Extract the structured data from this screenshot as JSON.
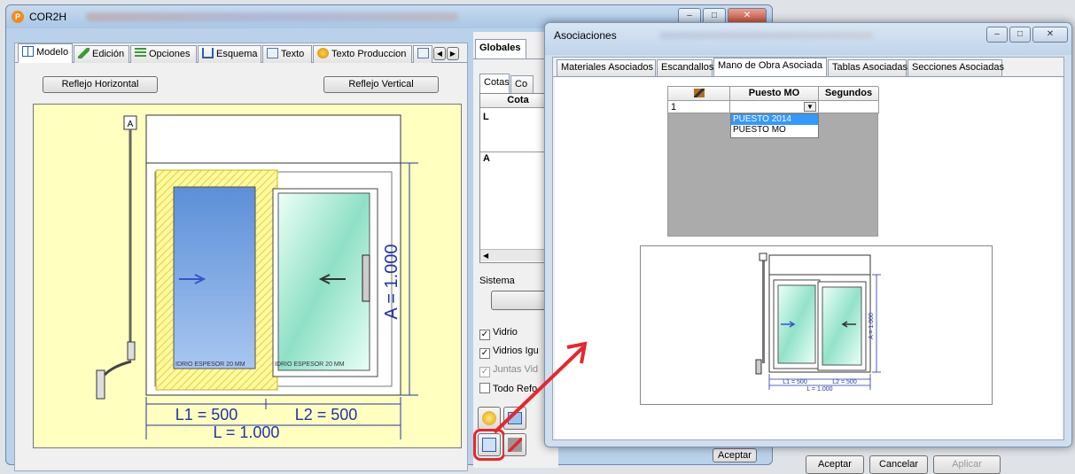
{
  "main_window": {
    "title": "COR2H",
    "app_icon_letter": "P",
    "tabs": [
      {
        "label": "Modelo",
        "icon": "grid-icon"
      },
      {
        "label": "Edición",
        "icon": "pencil-icon"
      },
      {
        "label": "Opciones",
        "icon": "list-icon"
      },
      {
        "label": "Esquema",
        "icon": "schema-icon"
      },
      {
        "label": "Texto",
        "icon": "document-icon"
      },
      {
        "label": "Texto Produccion",
        "icon": "gear-ball-icon"
      }
    ],
    "btn_reflejo_h": "Reflejo Horizontal",
    "btn_reflejo_v": "Reflejo Vertical",
    "drawing": {
      "A_label": "A = 1.000",
      "L1_label": "L1 = 500",
      "L2_label": "L2 = 500",
      "L_label": "L = 1.000",
      "glass_left": "IDRIO ESPESOR 20 MM",
      "glass_right": "IDRIO ESPESOR 20 MM",
      "handle_letter": "A"
    },
    "right_pane": {
      "tab_globales": "Globales",
      "subtab_cotas": "Cotas",
      "subtab_co": "Co",
      "col_cota": "Cota",
      "row_L": "L",
      "row_A": "A",
      "sistema_label": "Sistema",
      "checks": [
        {
          "label": "Vidrio",
          "checked": true
        },
        {
          "label": "Vidrios Igu",
          "checked": true
        },
        {
          "label": "Juntas Vid",
          "checked": true
        },
        {
          "label": "Todo Refo",
          "checked": false
        }
      ],
      "aceptar": "Aceptar"
    }
  },
  "asociaciones": {
    "title": "Asociaciones",
    "tabs": [
      "Materiales Asociados",
      "Escandallos",
      "Mano de Obra Asociada",
      "Tablas Asociadas",
      "Secciones Asociadas"
    ],
    "active_tab": "Mano de Obra Asociada",
    "grid": {
      "col_icon": "pin-icon",
      "col_puesto": "Puesto MO",
      "col_segundos": "Segundos",
      "row_num": "1",
      "dropdown_options": [
        "PUESTO 2014",
        "PUESTO MO"
      ],
      "dropdown_selected": "PUESTO 2014"
    },
    "preview": {
      "A_label": "A = 1.000",
      "L1_label": "L1 = 500",
      "L2_label": "L2 = 500",
      "L_label": "L = 1.000"
    },
    "buttons": {
      "aceptar": "Aceptar",
      "cancelar": "Cancelar",
      "aplicar": "Aplicar"
    }
  },
  "colors": {
    "annotation": "#e8262b",
    "selection": "#3399ff",
    "canvas": "#ffffc0"
  }
}
